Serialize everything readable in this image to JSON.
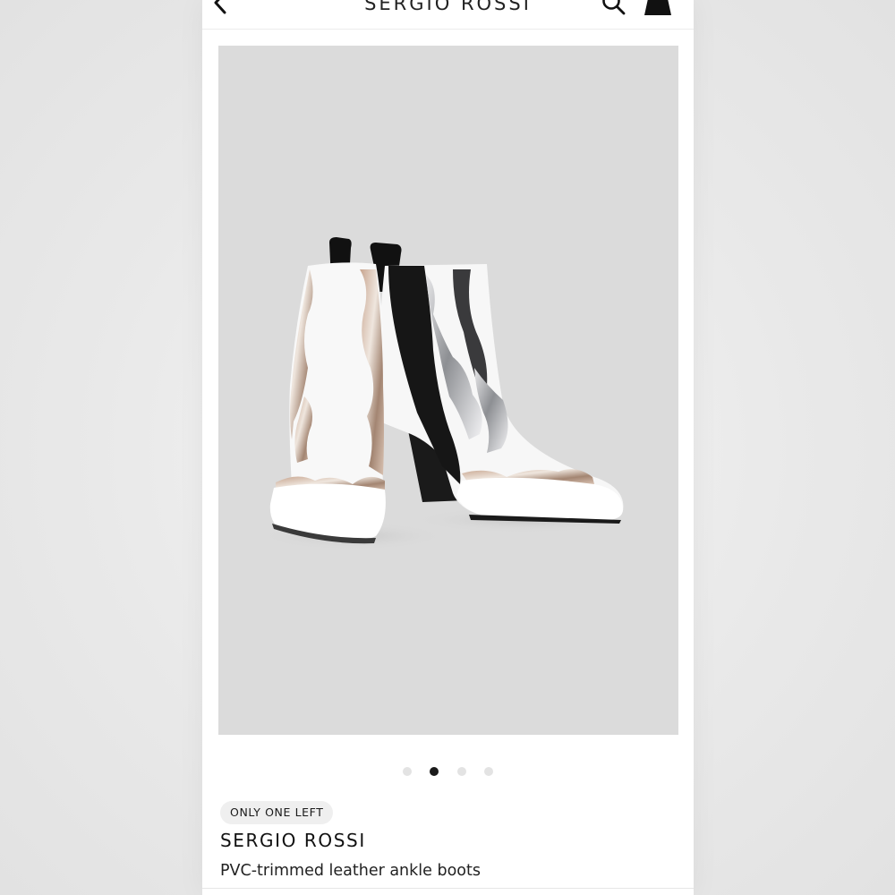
{
  "header": {
    "back_icon": "chevron-left-icon",
    "brand_title": "SERGIO ROSSI",
    "search_icon": "search-icon",
    "bag_icon": "shopping-bag-icon"
  },
  "gallery": {
    "image_description_icon": "product-photo",
    "total_images": 4,
    "active_index": 1,
    "active_dot_color": "#1a1a1a",
    "inactive_dot_color": "#e3e3e3",
    "background_color": "#dbdbdb"
  },
  "product": {
    "badge": "ONLY ONE LEFT",
    "designer": "SERGIO ROSSI",
    "name": "PVC-trimmed leather ankle boots"
  }
}
